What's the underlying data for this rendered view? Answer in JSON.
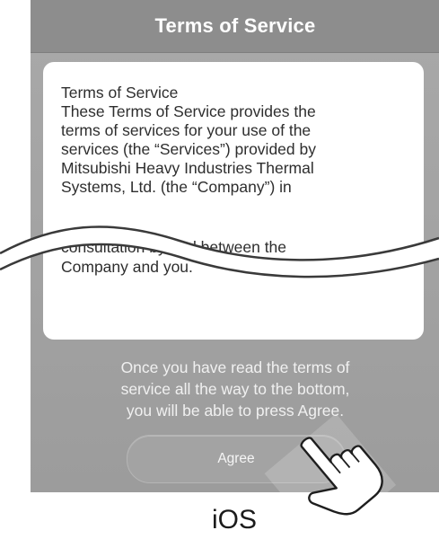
{
  "nav": {
    "title": "Terms of Service"
  },
  "terms": {
    "lines": [
      "Terms of Service",
      "These Terms of Service provides the",
      "terms of services for your use of the",
      "services (the “Services”) provided by",
      "Mitsubishi Heavy Industries Thermal",
      "Systems, Ltd. (the “Company”) in"
    ],
    "tail_lines": [
      "consultation by and between the",
      "Company and you."
    ]
  },
  "instructions": [
    "Once you have read the terms of",
    "service all the way to the bottom,",
    "you will be able to press Agree."
  ],
  "agree_button": {
    "label": "Agree"
  },
  "platform_label": "iOS",
  "icons": {
    "hand": "tap-hand-icon",
    "break": "wave-break-icon"
  }
}
